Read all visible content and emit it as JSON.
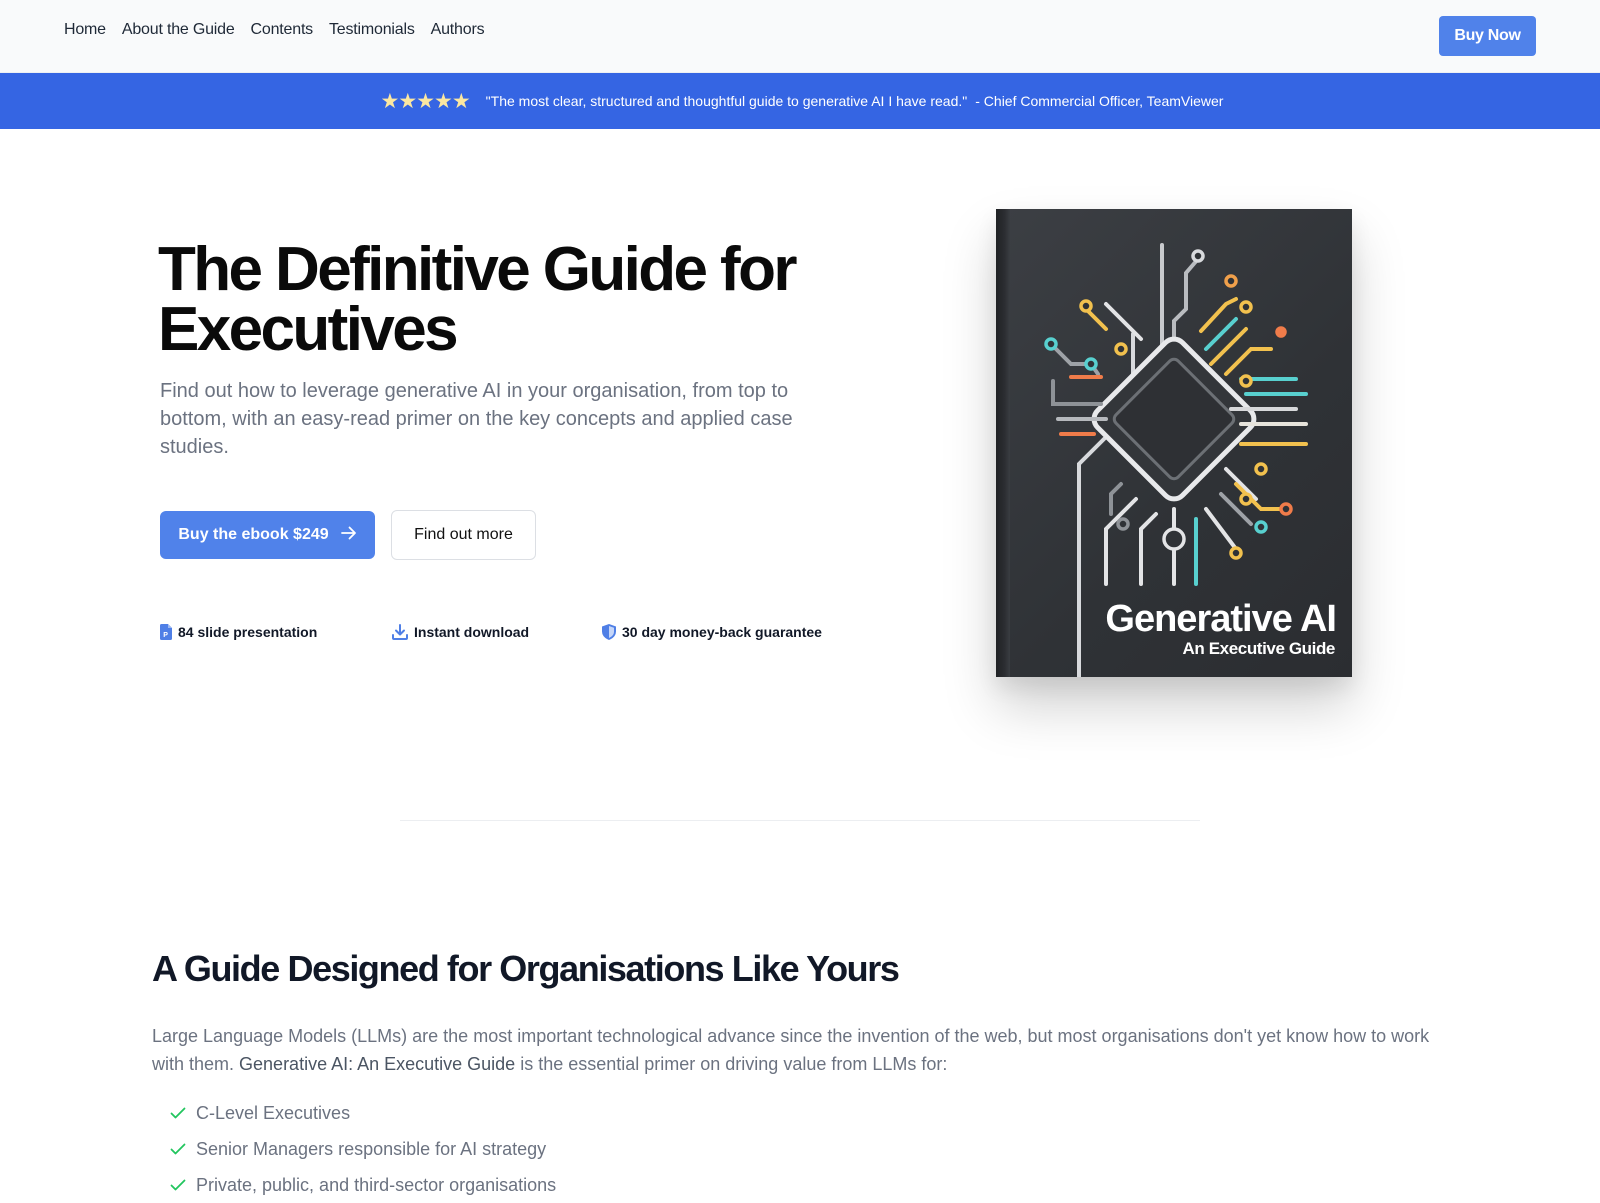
{
  "nav": {
    "links": [
      "Home",
      "About the Guide",
      "Contents",
      "Testimonials",
      "Authors"
    ],
    "cta_label": "Buy Now"
  },
  "banner": {
    "rating_icon": "star-icon",
    "stars": "★★★★★",
    "rating": 5,
    "quote": "\"The most clear, structured and thoughtful guide to generative AI I have read.\"",
    "attribution": "- Chief Commercial Officer, TeamViewer"
  },
  "hero": {
    "title": "The Definitive Guide for Executives",
    "subtitle": "Find out how to leverage generative AI in your organisation, from top to bottom, with an easy-read primer on the key concepts and applied case studies.",
    "primary_button": "Buy the ebook $249",
    "primary_button_icon": "arrow-right-icon",
    "secondary_button": "Find out more",
    "features": [
      {
        "icon": "document-icon",
        "label": "84 slide presentation"
      },
      {
        "icon": "download-icon",
        "label": "Instant download"
      },
      {
        "icon": "shield-icon",
        "label": "30 day money-back guarantee"
      }
    ]
  },
  "book": {
    "title": "Generative AI",
    "subtitle": "An Executive Guide",
    "cover_art": "circuit-chip-illustration"
  },
  "section": {
    "title": "A Guide Designed for Organisations Like Yours",
    "body_before": "Large Language Models (LLMs) are the most important technological advance since the invention of the web, but most organisations don't yet know how to work with them. ",
    "body_strong": "Generative AI: An Executive Guide",
    "body_after": " is the essential primer on driving value from LLMs for:",
    "check_icon": "check-icon",
    "audiences": [
      "C-Level Executives",
      "Senior Managers responsible for AI strategy",
      "Private, public, and third-sector organisations"
    ]
  },
  "colors": {
    "brand_blue": "#5082ea",
    "banner_blue": "#3565e3",
    "star_yellow": "#fbe7a1",
    "check_green": "#22c55e",
    "book_cover": "#2f3236"
  }
}
